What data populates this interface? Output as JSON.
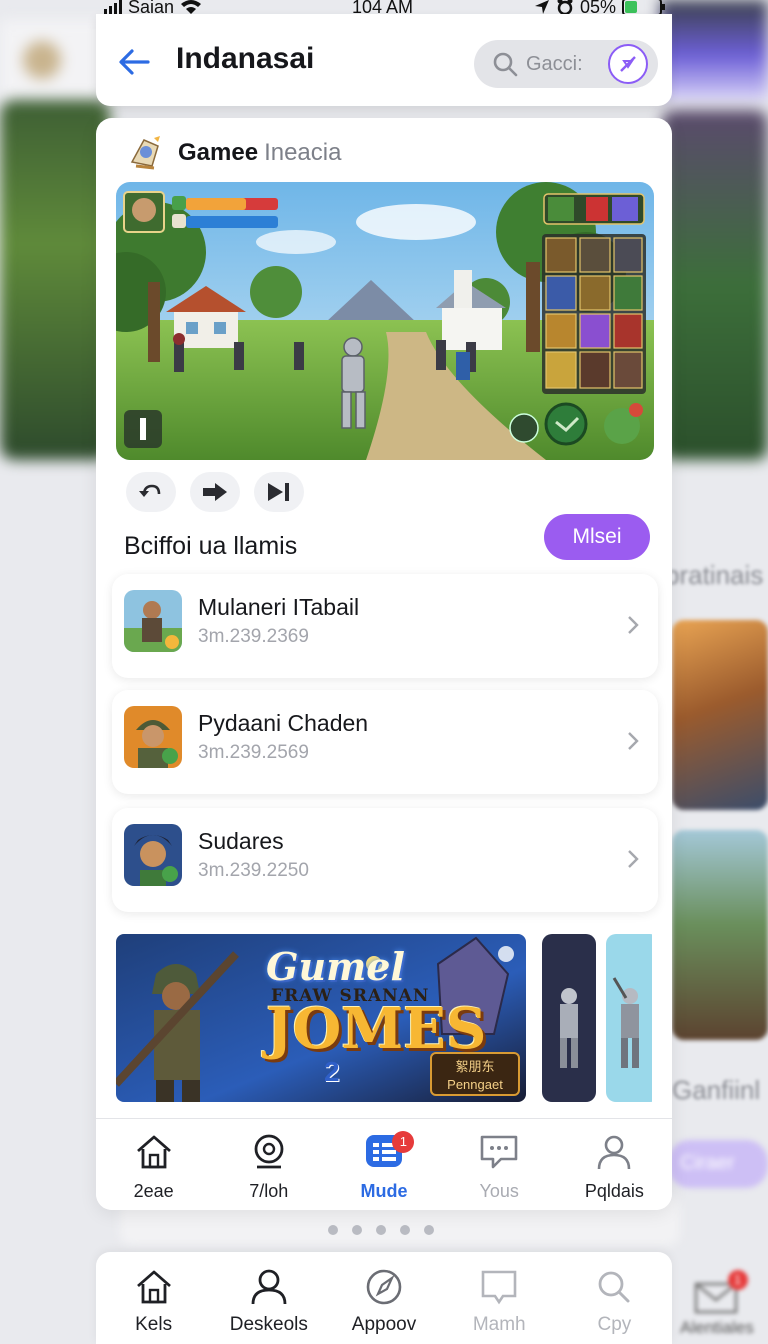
{
  "status_bar": {
    "carrier": "Saian",
    "time": "104 AM",
    "battery": "05%",
    "battery_level": 0.35
  },
  "header": {
    "back_label": "←",
    "title": "Indanasai",
    "search_placeholder": "Gacci:"
  },
  "game": {
    "name": "Gamee",
    "subtitle": "Ineacia"
  },
  "section": {
    "title": "Bciffoi ua llamis",
    "more_button": "Mlsei"
  },
  "list": [
    {
      "name": "Mulaneri ITabail",
      "meta": "3m.239.2369",
      "icon": "soldier-thumbnail-icon"
    },
    {
      "name": "Pydaani Chaden",
      "meta": "3m.239.2569",
      "icon": "helmet-soldier-icon"
    },
    {
      "name": "Sudares",
      "meta": "3m.239.2250",
      "icon": "hero-portrait-icon"
    }
  ],
  "banner": {
    "line1": "Gumel",
    "line2": "FRAW SRANAN",
    "line3": "JOMES",
    "line4": "2",
    "badge": "絮朋东 Penngaet"
  },
  "tabs": [
    {
      "label": "2eae",
      "icon": "home-icon"
    },
    {
      "label": "7/loh",
      "icon": "chat-bubble-icon"
    },
    {
      "label": "Mude",
      "icon": "grid-menu-icon",
      "badge": "1",
      "active": true
    },
    {
      "label": "Yous",
      "icon": "message-icon"
    },
    {
      "label": "Pqldais",
      "icon": "profile-icon"
    }
  ],
  "bottom_nav": [
    {
      "label": "Kels",
      "icon": "home-icon"
    },
    {
      "label": "Deskeols",
      "icon": "profile-icon"
    },
    {
      "label": "Appoov",
      "icon": "compass-icon"
    },
    {
      "label": "Mamh",
      "icon": "bookmark-icon"
    },
    {
      "label": "Cpy",
      "icon": "search-icon"
    }
  ],
  "background": {
    "right_label_1": "pratinais",
    "right_label_2": "Ganfiinl",
    "right_button": "Ciraer",
    "far_right_label": "Alentiales",
    "far_right_badge": "1"
  },
  "colors": {
    "accent_purple": "#9b5cf0",
    "active_blue": "#2c6be3",
    "badge_red": "#e63b3b"
  }
}
